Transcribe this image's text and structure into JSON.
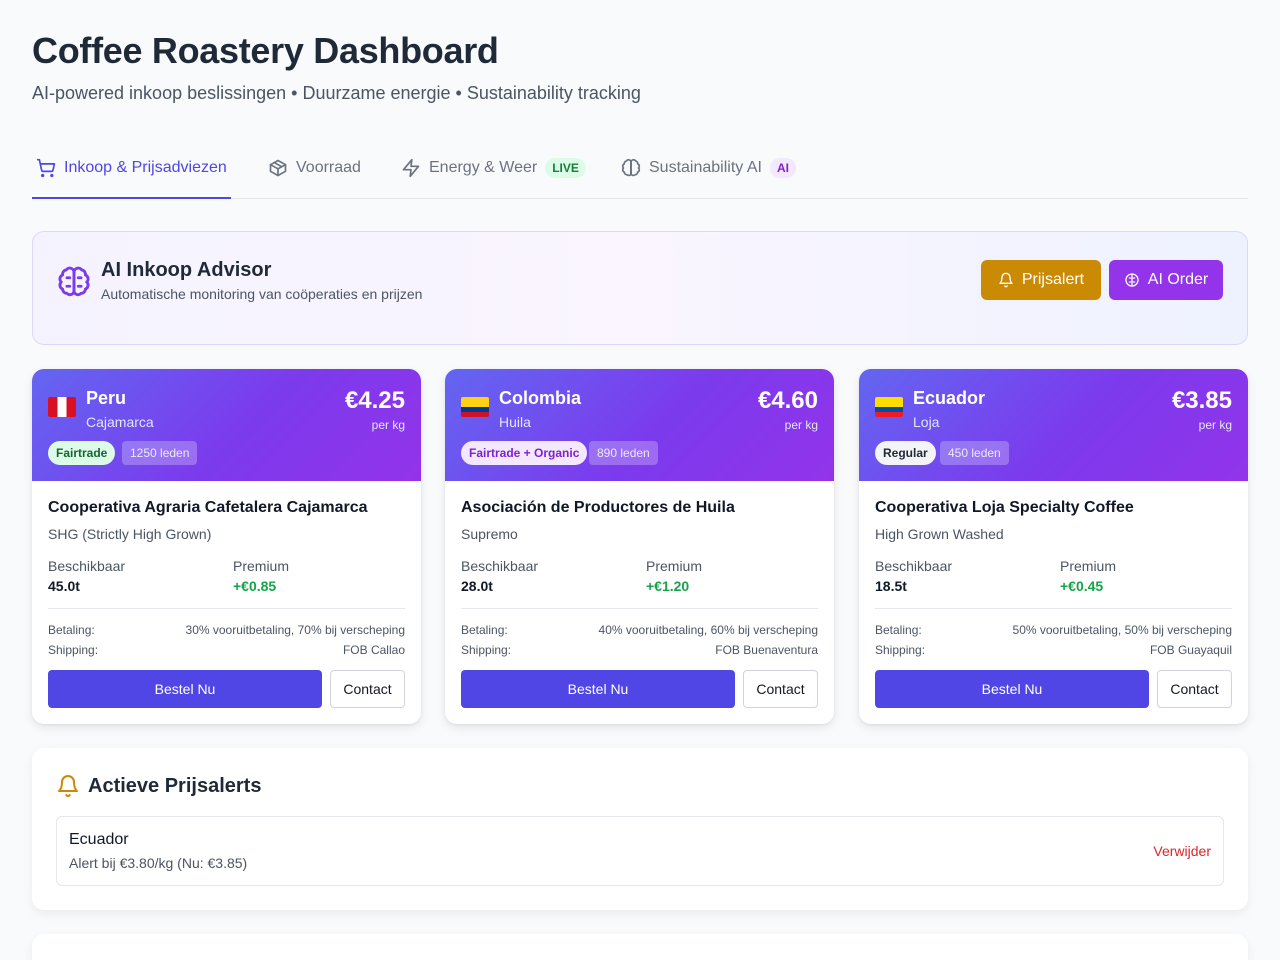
{
  "header": {
    "title": "Coffee Roastery Dashboard",
    "subtitle": "AI-powered inkoop beslissingen • Duurzame energie • Sustainability tracking"
  },
  "tabs": [
    {
      "label": "Inkoop & Prijsadviezen",
      "icon": "shopping-cart-icon",
      "active": true
    },
    {
      "label": "Voorraad",
      "icon": "package-icon"
    },
    {
      "label": "Energy & Weer",
      "icon": "lightning-icon",
      "badge": "LIVE"
    },
    {
      "label": "Sustainability AI",
      "icon": "brain-icon",
      "badge": "AI"
    }
  ],
  "advisor": {
    "title": "AI Inkoop Advisor",
    "description": "Automatische monitoring van coöperaties en prijzen",
    "alert_button": "Prijsalert",
    "order_button": "AI Order"
  },
  "cards": [
    {
      "country": "Peru",
      "region": "Cajamarca",
      "price": "€4.25",
      "per_kg": "per kg",
      "certification": "Fairtrade",
      "members": "1250 leden",
      "cooperative": "Cooperativa Agraria Cafetalera Cajamarca",
      "grade": "SHG (Strictly High Grown)",
      "available_label": "Beschikbaar",
      "available": "45.0t",
      "premium_label": "Premium",
      "premium": "+€0.85",
      "payment_label": "Betaling:",
      "payment": "30% vooruitbetaling, 70% bij verscheping",
      "shipping_label": "Shipping:",
      "shipping": "FOB Callao",
      "order_button": "Bestel Nu",
      "contact_button": "Contact"
    },
    {
      "country": "Colombia",
      "region": "Huila",
      "price": "€4.60",
      "per_kg": "per kg",
      "certification": "Fairtrade + Organic",
      "members": "890 leden",
      "cooperative": "Asociación de Productores de Huila",
      "grade": "Supremo",
      "available_label": "Beschikbaar",
      "available": "28.0t",
      "premium_label": "Premium",
      "premium": "+€1.20",
      "payment_label": "Betaling:",
      "payment": "40% vooruitbetaling, 60% bij verscheping",
      "shipping_label": "Shipping:",
      "shipping": "FOB Buenaventura",
      "order_button": "Bestel Nu",
      "contact_button": "Contact"
    },
    {
      "country": "Ecuador",
      "region": "Loja",
      "price": "€3.85",
      "per_kg": "per kg",
      "certification": "Regular",
      "members": "450 leden",
      "cooperative": "Cooperativa Loja Specialty Coffee",
      "grade": "High Grown Washed",
      "available_label": "Beschikbaar",
      "available": "18.5t",
      "premium_label": "Premium",
      "premium": "+€0.45",
      "payment_label": "Betaling:",
      "payment": "50% vooruitbetaling, 50% bij verscheping",
      "shipping_label": "Shipping:",
      "shipping": "FOB Guayaquil",
      "order_button": "Bestel Nu",
      "contact_button": "Contact"
    }
  ],
  "alerts": {
    "title": "Actieve Prijsalerts",
    "items": [
      {
        "country": "Ecuador",
        "text": "Alert bij €3.80/kg (Nu: €3.85)",
        "remove": "Verwijder"
      }
    ]
  },
  "colors": {
    "accent": "#4f46e5",
    "purple": "#9333ea",
    "amber": "#ca8a04",
    "green": "#16a34a",
    "red": "#dc2626"
  }
}
